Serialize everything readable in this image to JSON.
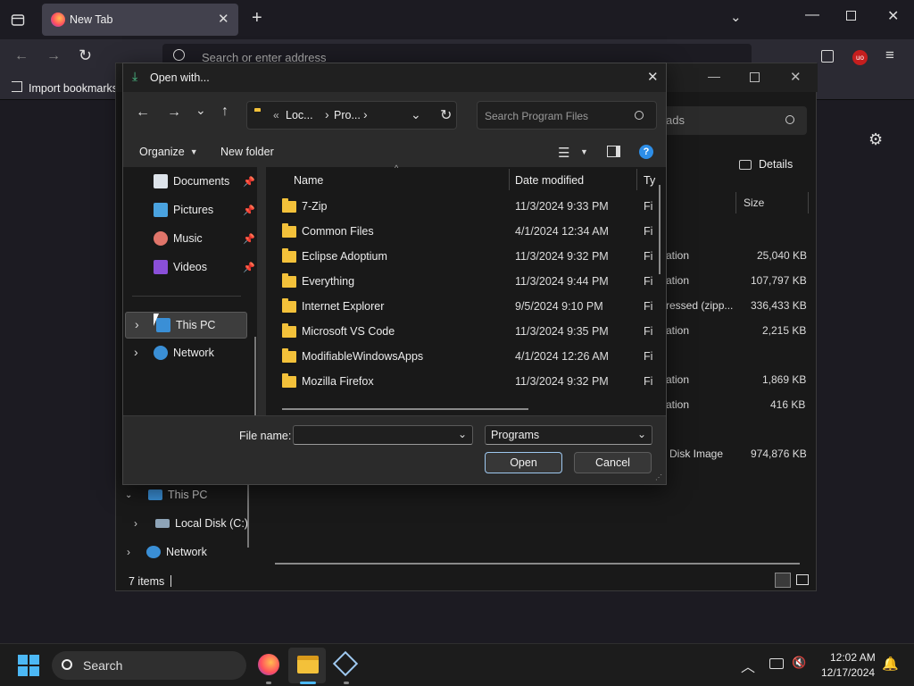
{
  "browser": {
    "tab_title": "New Tab",
    "address_placeholder": "Search or enter address",
    "bookmark_import": "Import bookmarks",
    "addon_badge": "uo"
  },
  "explorer": {
    "search_partial": "ads",
    "details_label": "Details",
    "size_header": "Size",
    "rows": [
      {
        "type": "ation",
        "size": "25,040 KB"
      },
      {
        "type": "ation",
        "size": "107,797 KB"
      },
      {
        "type": "ressed (zipp...",
        "size": "336,433 KB"
      },
      {
        "type": "ation",
        "size": "2,215 KB"
      },
      {
        "type": "ation",
        "size": "1,869 KB"
      },
      {
        "type": "ation",
        "size": "416 KB"
      },
      {
        "type": "Disk Image",
        "size": "974,876 KB"
      }
    ],
    "sidebar": {
      "this_pc": "This PC",
      "local_disk": "Local Disk (C:)",
      "network": "Network"
    },
    "status": "7 items"
  },
  "dialog": {
    "title": "Open with...",
    "path": {
      "sep": "«",
      "seg1": "Loc...",
      "seg2": "Pro..."
    },
    "search_placeholder": "Search Program Files",
    "organize": "Organize",
    "new_folder": "New folder",
    "nav": [
      {
        "label": "Documents",
        "pinned": true
      },
      {
        "label": "Pictures",
        "pinned": true
      },
      {
        "label": "Music",
        "pinned": true
      },
      {
        "label": "Videos",
        "pinned": true
      },
      {
        "label": "This PC"
      },
      {
        "label": "Network"
      }
    ],
    "columns": {
      "name": "Name",
      "date": "Date modified",
      "type": "Ty"
    },
    "files": [
      {
        "name": "7-Zip",
        "date": "11/3/2024 9:33 PM",
        "type": "Fi"
      },
      {
        "name": "Common Files",
        "date": "4/1/2024 12:34 AM",
        "type": "Fi"
      },
      {
        "name": "Eclipse Adoptium",
        "date": "11/3/2024 9:32 PM",
        "type": "Fi"
      },
      {
        "name": "Everything",
        "date": "11/3/2024 9:44 PM",
        "type": "Fi"
      },
      {
        "name": "Internet Explorer",
        "date": "9/5/2024 9:10 PM",
        "type": "Fi"
      },
      {
        "name": "Microsoft VS Code",
        "date": "11/3/2024 9:35 PM",
        "type": "Fi"
      },
      {
        "name": "ModifiableWindowsApps",
        "date": "4/1/2024 12:26 AM",
        "type": "Fi"
      },
      {
        "name": "Mozilla Firefox",
        "date": "11/3/2024 9:32 PM",
        "type": "Fi"
      }
    ],
    "file_name_label": "File name:",
    "file_name_value": "",
    "file_type": "Programs",
    "open": "Open",
    "cancel": "Cancel"
  },
  "taskbar": {
    "search": "Search",
    "time": "12:02 AM",
    "date": "12/17/2024"
  },
  "colors": {
    "accent": "#0067c0",
    "folder": "#f3c13a"
  }
}
